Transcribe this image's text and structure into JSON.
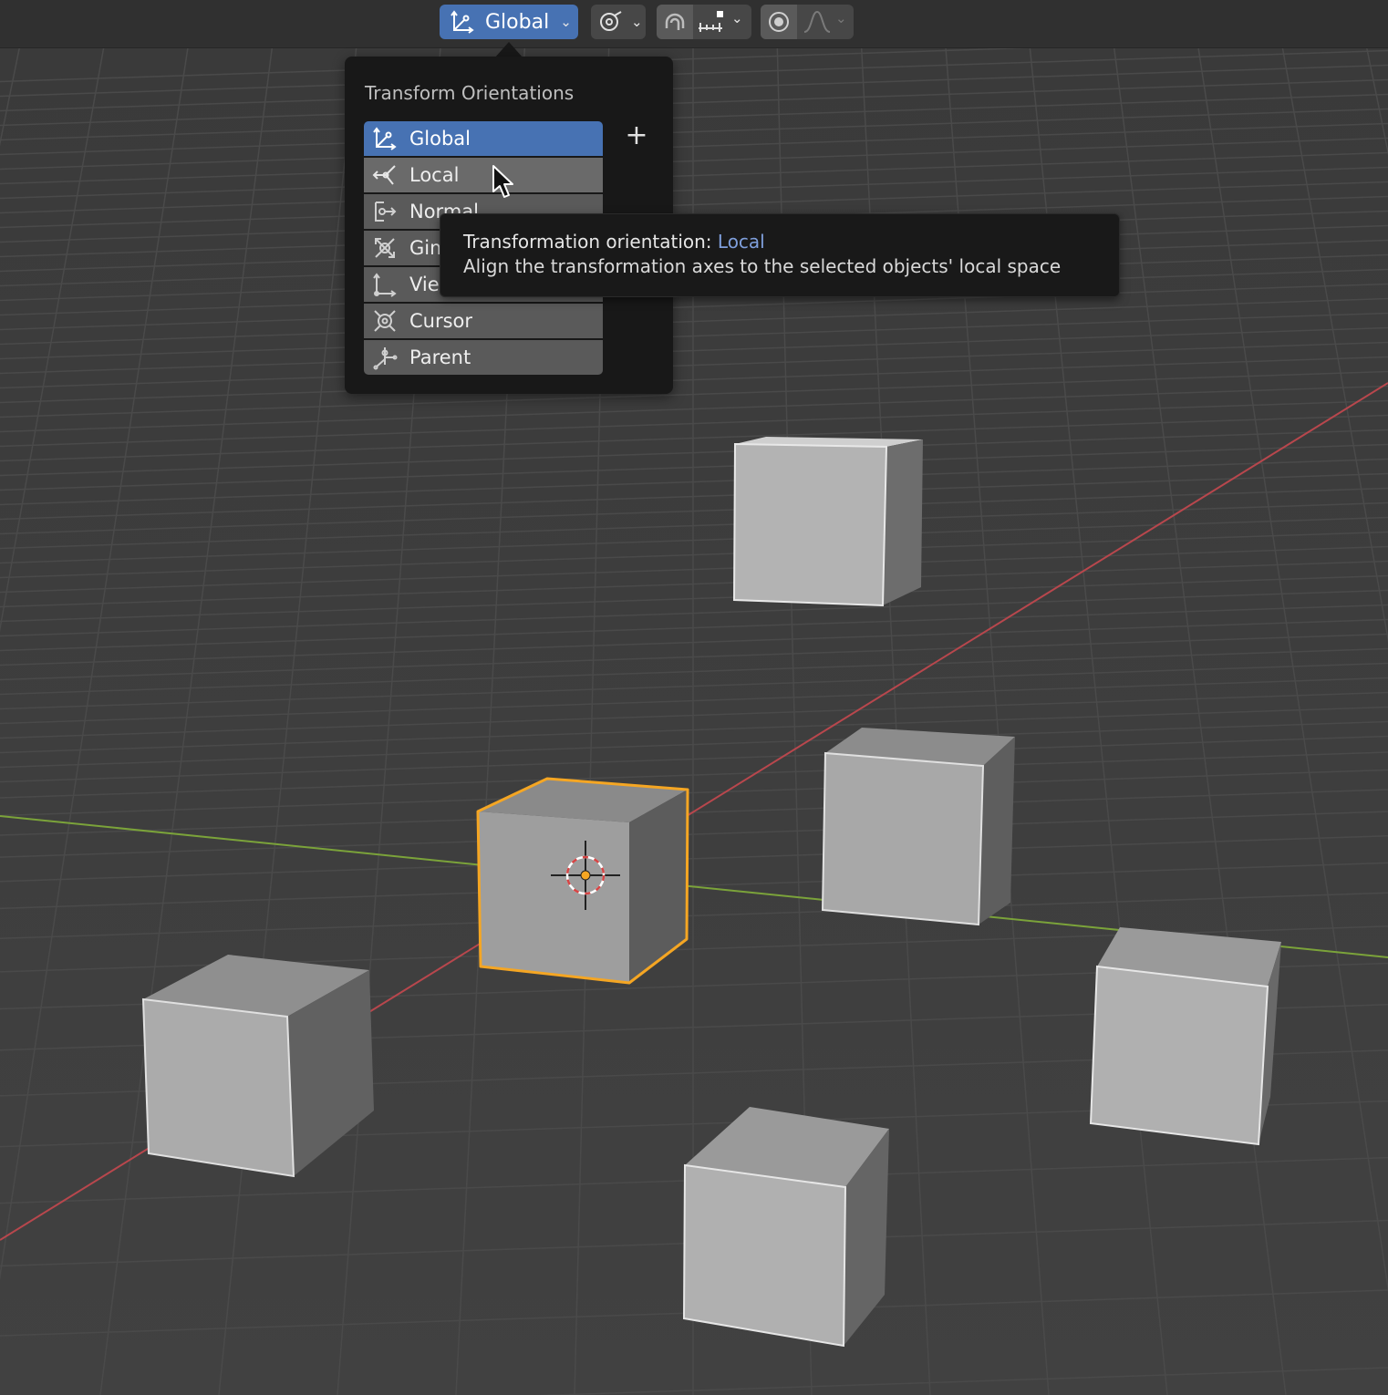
{
  "header": {
    "orientation_label": "Global",
    "icons": [
      "orientation-global-icon",
      "chevron-down-icon",
      "pivot-point-icon",
      "snap-magnet-icon",
      "snap-increment-icon",
      "proportional-editing-icon",
      "falloff-curve-icon"
    ]
  },
  "menu": {
    "title": "Transform Orientations",
    "add_label": "+",
    "items": [
      {
        "label": "Global",
        "icon": "orientation-global-icon",
        "state": "selected"
      },
      {
        "label": "Local",
        "icon": "orientation-local-icon",
        "state": "hover"
      },
      {
        "label": "Normal",
        "icon": "orientation-normal-icon"
      },
      {
        "label": "Gimbal",
        "icon": "orientation-gimbal-icon"
      },
      {
        "label": "View",
        "icon": "orientation-view-icon"
      },
      {
        "label": "Cursor",
        "icon": "orientation-cursor-icon"
      },
      {
        "label": "Parent",
        "icon": "orientation-parent-icon"
      }
    ]
  },
  "tooltip": {
    "prefix": "Transformation orientation: ",
    "value": "Local",
    "description": "Align the transformation axes to the selected objects' local space"
  },
  "colors": {
    "accent": "#4772b3",
    "selection_outline": "#f5a623",
    "x_axis": "#b8474d",
    "y_axis": "#7ba33a",
    "viewport_bg": "#3d3d3d"
  }
}
